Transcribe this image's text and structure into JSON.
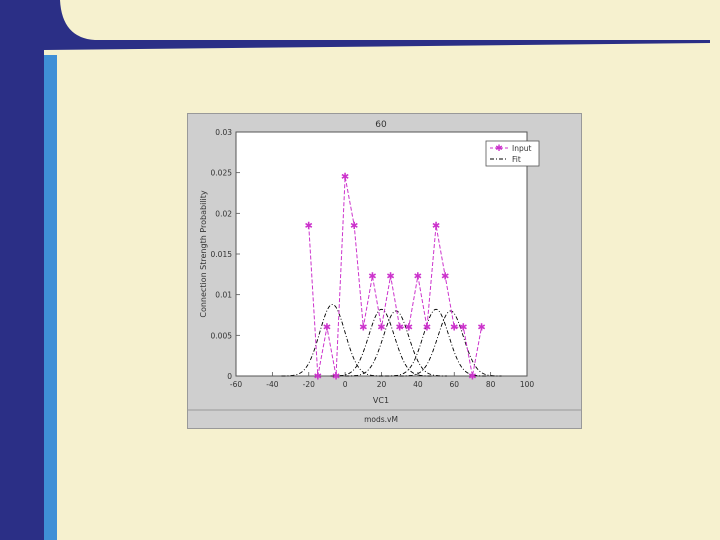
{
  "colors": {
    "background": "#f6f1cf",
    "left_bar": "#2b2f86",
    "accent_bar": "#3f8fd6",
    "top_curve": "#2b2f86",
    "input_series": "#cc33cc",
    "fit_series": "#000000"
  },
  "figure": {
    "title": "60",
    "bottom_caption": "mods.vM"
  },
  "chart_data": {
    "type": "line",
    "title": "60",
    "xlabel": "VC1",
    "ylabel": "Connection Strength Probability",
    "xlim": [
      -60,
      100
    ],
    "ylim": [
      0,
      0.03
    ],
    "xticks": [
      "-60",
      "-40",
      "-20",
      "0",
      "20",
      "40",
      "60",
      "80",
      "100"
    ],
    "yticks": [
      "0",
      "0.005",
      "0.01",
      "0.015",
      "0.02",
      "0.025",
      "0.03"
    ],
    "legend": {
      "position": "top-right",
      "entries": [
        "Input",
        "Fit"
      ]
    },
    "series": [
      {
        "name": "Input",
        "color": "#cc33cc",
        "marker": "star",
        "dash": "dash",
        "x": [
          -20,
          -15,
          -10,
          -5,
          0,
          5,
          10,
          15,
          20,
          25,
          30,
          35,
          40,
          45,
          50,
          55,
          60,
          65,
          70,
          75,
          80
        ],
        "y": [
          0.0185,
          0.0,
          0.006,
          0.0,
          0.0245,
          0.0185,
          0.006,
          0.0123,
          0.006,
          0.0123,
          0.006,
          0.006,
          0.0123,
          0.006,
          0.0185,
          0.0123,
          0.006,
          0.006,
          0.0,
          0.006,
          null
        ]
      },
      {
        "name": "Fit",
        "color": "#000000",
        "dash": "dashdot",
        "components": [
          {
            "mu": -7,
            "sigma": 7,
            "amp": 0.0088
          },
          {
            "mu": 20,
            "sigma": 7,
            "amp": 0.0082
          },
          {
            "mu": 28,
            "sigma": 7,
            "amp": 0.008
          },
          {
            "mu": 50,
            "sigma": 7,
            "amp": 0.0082
          },
          {
            "mu": 58,
            "sigma": 7,
            "amp": 0.008
          }
        ]
      }
    ]
  }
}
